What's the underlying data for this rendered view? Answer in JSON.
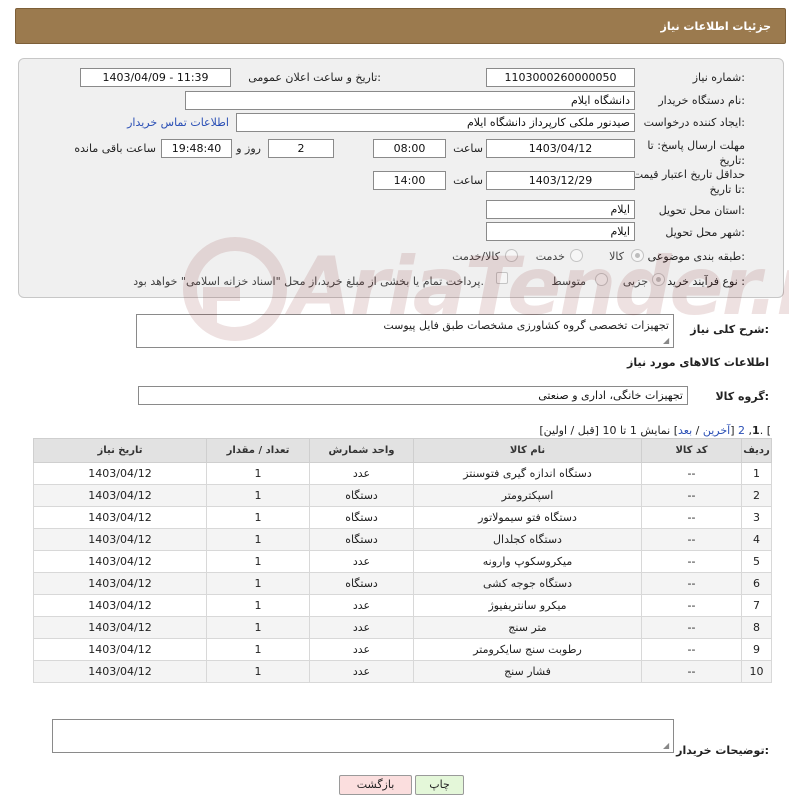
{
  "header": {
    "title": "جزئیات اطلاعات نیاز"
  },
  "form": {
    "need_number_label": "شماره نیاز:",
    "need_number": "1103000260000050",
    "announce_label": "تاریخ و ساعت اعلان عمومی:",
    "announce_value": "1403/04/09 - 11:39",
    "buyer_org_label": "نام دستگاه خریدار:",
    "buyer_org": "دانشگاه ایلام",
    "requester_label": "ایجاد کننده درخواست:",
    "requester": "صیدنور ملکی کارپرداز دانشگاه ایلام",
    "contact_link": "اطلاعات تماس خریدار",
    "deadline_label": "مهلت ارسال پاسخ: تا تاریخ:",
    "deadline_date": "1403/04/12",
    "time_label": "ساعت",
    "deadline_time": "08:00",
    "days_value": "2",
    "days_label": "روز و",
    "remaining_time": "19:48:40",
    "remaining_label": "ساعت باقی مانده",
    "validity_label": "حداقل تاریخ اعتبار قیمت: تا تاریخ:",
    "validity_date": "1403/12/29",
    "validity_time": "14:00",
    "province_label": "استان محل تحویل:",
    "province": "ایلام",
    "city_label": "شهر محل تحویل:",
    "city": "ایلام",
    "category_label": "طبقه بندی موضوعی:",
    "category_options": [
      "کالا",
      "خدمت",
      "کالا/خدمت"
    ],
    "process_label": "نوع فرآیند خرید :",
    "process_options": [
      "جزیی",
      "متوسط"
    ],
    "payment_note": "پرداخت تمام یا بخشی از مبلغ خرید،از محل \"اسناد خزانه اسلامی\" خواهد بود."
  },
  "summary": {
    "label": "شرح کلی نیاز:",
    "text": "تجهیزات تخصصی گروه کشاورزی  مشخصات طبق فایل پیوست"
  },
  "goods_section_title": "اطلاعات کالاهای مورد نیاز",
  "goods_group": {
    "label": "گروه کالا:",
    "value": "تجهیزات خانگی، اداری و صنعتی"
  },
  "pager": {
    "prefix": "نمایش 1 تا 10. [",
    "last": "آخرین",
    "next": "بعد",
    "page2": "2",
    "page1": "1",
    "tail": "[قبل / اولین]"
  },
  "table": {
    "headers": [
      "ردیف",
      "کد کالا",
      "نام کالا",
      "واحد شمارش",
      "تعداد / مقدار",
      "تاریخ نیاز"
    ],
    "rows": [
      [
        "1",
        "--",
        "دستگاه اندازه گیری فتوسنتز",
        "عدد",
        "1",
        "1403/04/12"
      ],
      [
        "2",
        "--",
        "اسپکترومتر",
        "دستگاه",
        "1",
        "1403/04/12"
      ],
      [
        "3",
        "--",
        "دستگاه فتو سیمولاتور",
        "دستگاه",
        "1",
        "1403/04/12"
      ],
      [
        "4",
        "--",
        "دستگاه کجلدال",
        "دستگاه",
        "1",
        "1403/04/12"
      ],
      [
        "5",
        "--",
        "میکروسکوپ وارونه",
        "عدد",
        "1",
        "1403/04/12"
      ],
      [
        "6",
        "--",
        "دستگاه جوجه کشی",
        "دستگاه",
        "1",
        "1403/04/12"
      ],
      [
        "7",
        "--",
        "میکرو سانتریفیوژ",
        "عدد",
        "1",
        "1403/04/12"
      ],
      [
        "8",
        "--",
        "متر سنج",
        "عدد",
        "1",
        "1403/04/12"
      ],
      [
        "9",
        "--",
        "رطوبت سنج سایکرومتر",
        "عدد",
        "1",
        "1403/04/12"
      ],
      [
        "10",
        "--",
        "فشار سنج",
        "عدد",
        "1",
        "1403/04/12"
      ]
    ]
  },
  "buyer_notes": {
    "label": "توضیحات خریدار:",
    "value": ""
  },
  "buttons": {
    "print": "چاپ",
    "back": "بازگشت"
  },
  "watermark": "AriaTender.net",
  "colors": {
    "header": "#9b7a4e",
    "link": "#2a4fb5",
    "print_btn": "#e4f7d9",
    "back_btn": "#fbdede"
  }
}
